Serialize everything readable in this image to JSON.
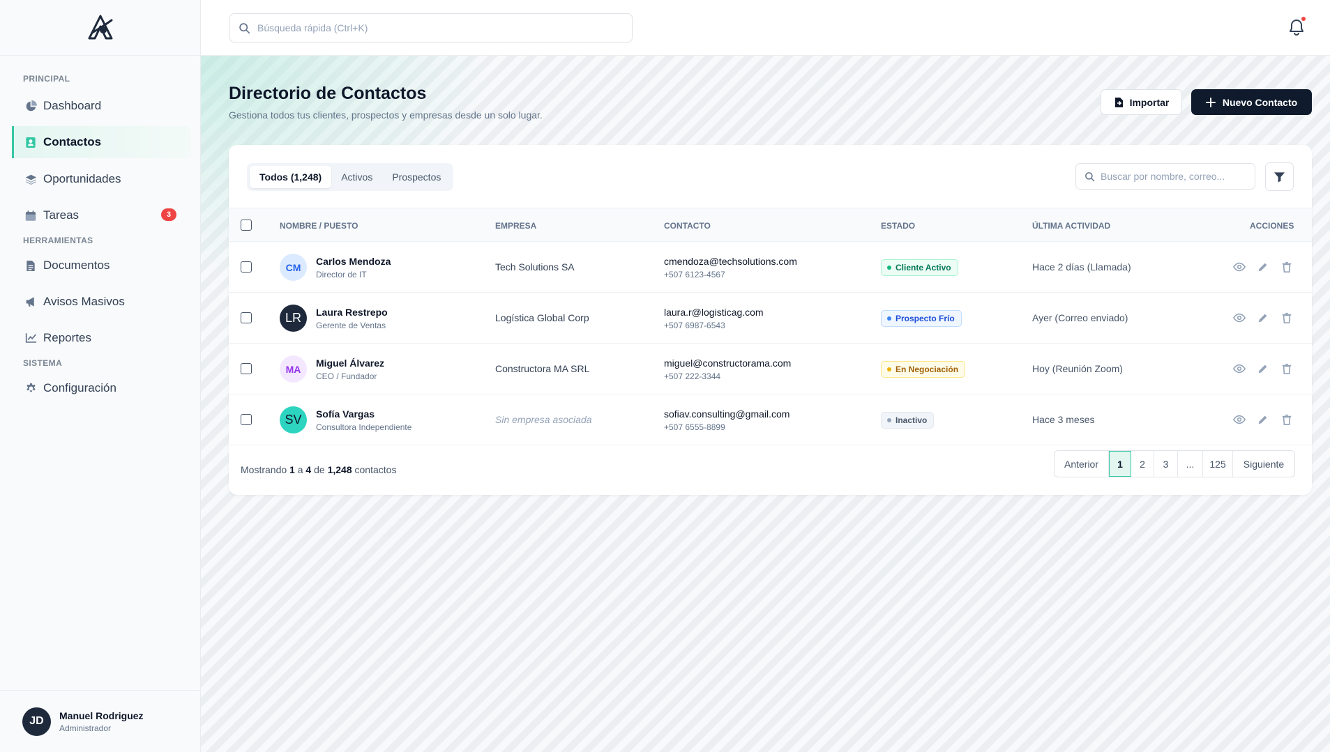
{
  "sidebar": {
    "sections": [
      "PRINCIPAL",
      "HERRAMIENTAS",
      "SISTEMA"
    ],
    "items": [
      {
        "label": "Dashboard",
        "icon": "pie-chart-icon"
      },
      {
        "label": "Contactos",
        "icon": "contact-card-icon",
        "active": true
      },
      {
        "label": "Oportunidades",
        "icon": "layers-icon"
      },
      {
        "label": "Tareas",
        "icon": "calendar-icon",
        "badge": "3"
      },
      {
        "label": "Documentos",
        "icon": "document-icon"
      },
      {
        "label": "Avisos Masivos",
        "icon": "megaphone-icon"
      },
      {
        "label": "Reportes",
        "icon": "line-chart-icon"
      },
      {
        "label": "Configuración",
        "icon": "gear-icon"
      }
    ],
    "user": {
      "initials": "JD",
      "name": "Manuel Rodriguez",
      "role": "Administrador"
    }
  },
  "topbar": {
    "search_placeholder": "Búsqueda rápida (Ctrl+K)"
  },
  "header": {
    "title": "Directorio de Contactos",
    "subtitle": "Gestiona todos tus clientes, prospectos y empresas desde un solo lugar.",
    "import_label": "Importar",
    "new_label": "Nuevo Contacto"
  },
  "tabs": [
    "Todos (1,248)",
    "Activos",
    "Prospectos"
  ],
  "table_search_placeholder": "Buscar por nombre, correo...",
  "columns": [
    "NOMBRE / PUESTO",
    "EMPRESA",
    "CONTACTO",
    "ESTADO",
    "ÚLTIMA ACTIVIDAD",
    "ACCIONES"
  ],
  "rows": [
    {
      "initials": "CM",
      "name": "Carlos Mendoza",
      "position": "Director de IT",
      "company": "Tech Solutions SA",
      "email": "cmendoza@techsolutions.com",
      "phone": "+507 6123-4567",
      "status": "Cliente Activo",
      "activity": "Hace 2 días (Llamada)"
    },
    {
      "initials": "LR",
      "name": "Laura Restrepo",
      "position": "Gerente de Ventas",
      "company": "Logística Global Corp",
      "email": "laura.r@logisticag.com",
      "phone": "+507 6987-6543",
      "status": "Prospecto Frío",
      "activity": "Ayer (Correo enviado)"
    },
    {
      "initials": "MA",
      "name": "Miguel Álvarez",
      "position": "CEO / Fundador",
      "company": "Constructora MA SRL",
      "email": "miguel@constructorama.com",
      "phone": "+507 222-3344",
      "status": "En Negociación",
      "activity": "Hoy (Reunión Zoom)"
    },
    {
      "initials": "SV",
      "name": "Sofía Vargas",
      "position": "Consultora Independiente",
      "company": "Sin empresa asociada",
      "email": "sofiav.consulting@gmail.com",
      "phone": "+507 6555-8899",
      "status": "Inactivo",
      "activity": "Hace 3 meses"
    }
  ],
  "footer": {
    "prefix": "Mostrando",
    "from": "1",
    "mid1": "a",
    "to": "4",
    "mid2": "de",
    "total": "1,248",
    "suffix": "contactos"
  },
  "pagination": [
    "Anterior",
    "1",
    "2",
    "3",
    "...",
    "125",
    "Siguiente"
  ],
  "colors": {
    "accent": "#34c7a3",
    "primary_button": "#0f1b2d",
    "badge": "#ef4444"
  }
}
